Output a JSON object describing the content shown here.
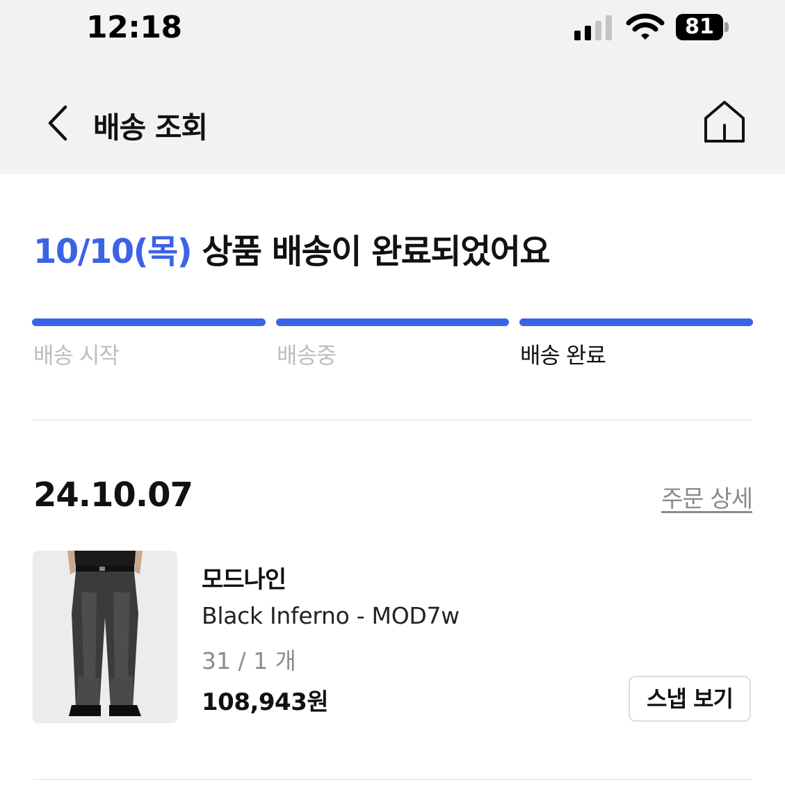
{
  "status_bar": {
    "time": "12:18",
    "battery_percent": "81",
    "signal_bars_active": 2,
    "signal_bars_total": 4
  },
  "nav": {
    "title": "배송 조회",
    "back_icon": "chevron-left-icon",
    "home_icon": "home-icon"
  },
  "headline": {
    "date": "10/10(목)",
    "message": " 상품 배송이 완료되었어요"
  },
  "progress": {
    "steps": [
      {
        "label": "배송 시작",
        "state": "done"
      },
      {
        "label": "배송중",
        "state": "done"
      },
      {
        "label": "배송 완료",
        "state": "current"
      }
    ]
  },
  "order": {
    "date": "24.10.07",
    "detail_link": "주문 상세",
    "item": {
      "brand": "모드나인",
      "name": "Black Inferno - MOD7w",
      "option": "31 / 1 개",
      "price": "108,943원",
      "snap_button": "스냅 보기",
      "thumbnail": "jeans-product-image"
    }
  },
  "colors": {
    "accent": "#3b63e6",
    "header_bg": "#f2f2f2",
    "muted_text": "#bdbdbd"
  }
}
